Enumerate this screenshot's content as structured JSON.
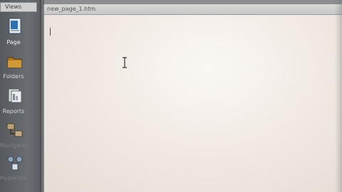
{
  "sidebar": {
    "header": "Views",
    "items": [
      {
        "label": "Page",
        "icon": "page-view-icon"
      },
      {
        "label": "Folders",
        "icon": "folders-icon"
      },
      {
        "label": "Reports",
        "icon": "reports-icon"
      },
      {
        "label": "Navigation",
        "icon": "navigation-icon"
      },
      {
        "label": "Hyperlinks",
        "icon": "hyperlinks-icon"
      }
    ]
  },
  "document": {
    "tab_title": "new_page_1.htm",
    "content": ""
  },
  "colors": {
    "sidebar": "#6a6d71",
    "page": "#efe9e2",
    "tab": "#cfd0cf"
  }
}
